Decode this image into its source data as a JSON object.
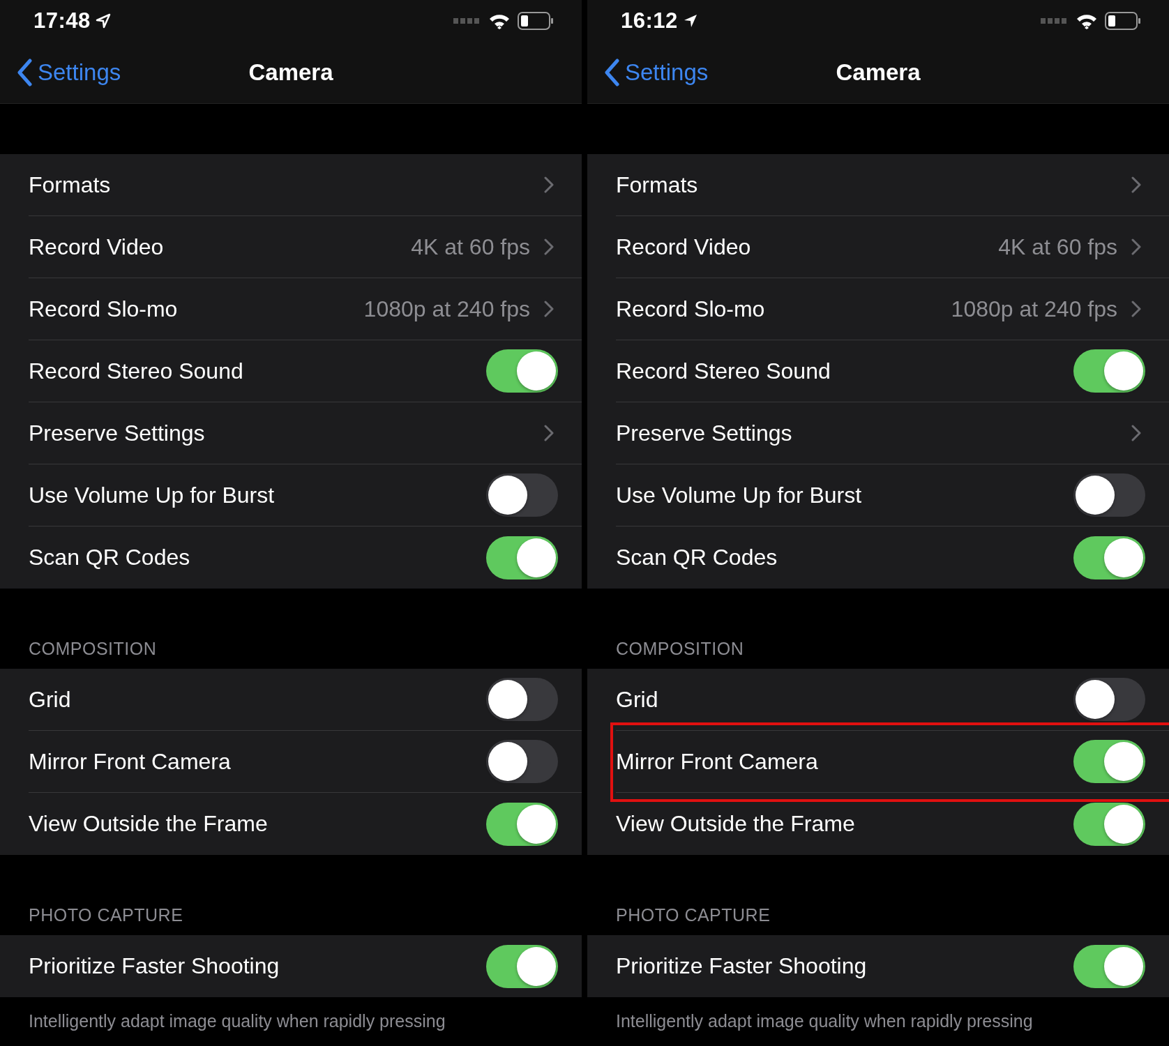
{
  "panels": [
    {
      "status_bar": {
        "time": "17:48",
        "location_filled": false
      },
      "nav": {
        "back": "Settings",
        "title": "Camera"
      },
      "sections": [
        {
          "rows": [
            {
              "kind": "link",
              "label": "Formats"
            },
            {
              "kind": "link",
              "label": "Record Video",
              "value": "4K at 60 fps"
            },
            {
              "kind": "link",
              "label": "Record Slo-mo",
              "value": "1080p at 240 fps"
            },
            {
              "kind": "toggle",
              "label": "Record Stereo Sound",
              "on": true
            },
            {
              "kind": "link",
              "label": "Preserve Settings"
            },
            {
              "kind": "toggle",
              "label": "Use Volume Up for Burst",
              "on": false
            },
            {
              "kind": "toggle",
              "label": "Scan QR Codes",
              "on": true
            }
          ]
        },
        {
          "header": "COMPOSITION",
          "rows": [
            {
              "kind": "toggle",
              "label": "Grid",
              "on": false
            },
            {
              "kind": "toggle",
              "label": "Mirror Front Camera",
              "on": false
            },
            {
              "kind": "toggle",
              "label": "View Outside the Frame",
              "on": true
            }
          ]
        },
        {
          "header": "PHOTO CAPTURE",
          "rows": [
            {
              "kind": "toggle",
              "label": "Prioritize Faster Shooting",
              "on": true
            }
          ],
          "footer": "Intelligently adapt image quality when rapidly pressing"
        }
      ]
    },
    {
      "status_bar": {
        "time": "16:12",
        "location_filled": true
      },
      "nav": {
        "back": "Settings",
        "title": "Camera"
      },
      "sections": [
        {
          "rows": [
            {
              "kind": "link",
              "label": "Formats"
            },
            {
              "kind": "link",
              "label": "Record Video",
              "value": "4K at 60 fps"
            },
            {
              "kind": "link",
              "label": "Record Slo-mo",
              "value": "1080p at 240 fps"
            },
            {
              "kind": "toggle",
              "label": "Record Stereo Sound",
              "on": true
            },
            {
              "kind": "link",
              "label": "Preserve Settings"
            },
            {
              "kind": "toggle",
              "label": "Use Volume Up for Burst",
              "on": false
            },
            {
              "kind": "toggle",
              "label": "Scan QR Codes",
              "on": true
            }
          ]
        },
        {
          "header": "COMPOSITION",
          "rows": [
            {
              "kind": "toggle",
              "label": "Grid",
              "on": false
            },
            {
              "kind": "toggle",
              "label": "Mirror Front Camera",
              "on": true,
              "highlighted": true
            },
            {
              "kind": "toggle",
              "label": "View Outside the Frame",
              "on": true
            }
          ]
        },
        {
          "header": "PHOTO CAPTURE",
          "rows": [
            {
              "kind": "toggle",
              "label": "Prioritize Faster Shooting",
              "on": true
            }
          ],
          "footer": "Intelligently adapt image quality when rapidly pressing"
        }
      ]
    }
  ]
}
